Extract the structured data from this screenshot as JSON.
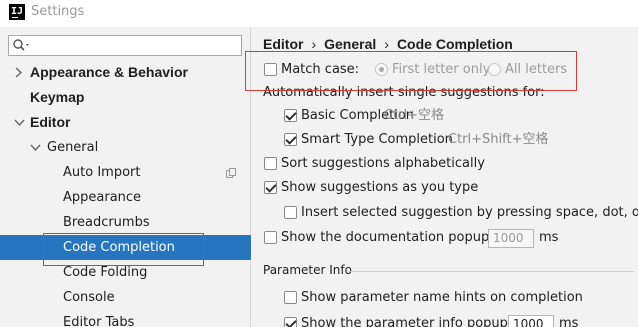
{
  "window": {
    "app_icon_text": "IJ",
    "title": "Settings"
  },
  "sidebar": {
    "search_placeholder": "",
    "items": [
      {
        "label": "Appearance & Behavior"
      },
      {
        "label": "Keymap"
      },
      {
        "label": "Editor"
      },
      {
        "label": "General"
      },
      {
        "label": "Auto Import"
      },
      {
        "label": "Appearance"
      },
      {
        "label": "Breadcrumbs"
      },
      {
        "label": "Code Completion"
      },
      {
        "label": "Code Folding"
      },
      {
        "label": "Console"
      },
      {
        "label": "Editor Tabs"
      }
    ]
  },
  "breadcrumb": {
    "part1": "Editor",
    "part2": "General",
    "part3": "Code Completion",
    "separator": "›"
  },
  "options": {
    "match_case": {
      "label": "Match case:",
      "checked": false
    },
    "first_letter_only": {
      "label": "First letter only",
      "selected": true
    },
    "all_letters": {
      "label": "All letters",
      "selected": false
    },
    "auto_insert_heading": "Automatically insert single suggestions for:",
    "basic_completion": {
      "label": "Basic Completion",
      "shortcut": "Ctrl+空格",
      "checked": true
    },
    "smart_type_completion": {
      "label": "Smart Type Completion",
      "shortcut": "Ctrl+Shift+空格",
      "checked": true
    },
    "sort_alphabetically": {
      "label": "Sort suggestions alphabetically",
      "checked": false
    },
    "show_as_you_type": {
      "label": "Show suggestions as you type",
      "checked": true
    },
    "insert_selected": {
      "label": "Insert selected suggestion by pressing space, dot, or othe",
      "checked": false
    },
    "doc_popup": {
      "label": "Show the documentation popup in",
      "value": "1000",
      "unit": "ms",
      "checked": false
    },
    "parameter_info_heading": "Parameter Info",
    "param_name_hints": {
      "label": "Show parameter name hints on completion",
      "checked": false
    },
    "param_info_popup": {
      "label": "Show the parameter info popup in",
      "value": "1000",
      "unit": "ms",
      "checked": true
    }
  }
}
